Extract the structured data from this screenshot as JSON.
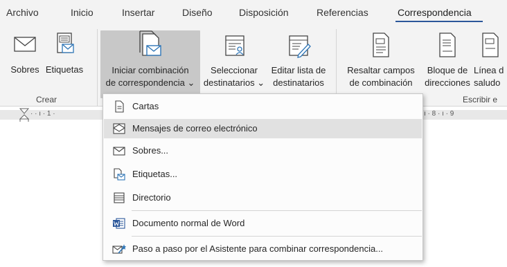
{
  "tabs": [
    "Archivo",
    "Inicio",
    "Insertar",
    "Diseño",
    "Disposición",
    "Referencias",
    "Correspondencia"
  ],
  "ribbon": {
    "sobres": "Sobres",
    "etiquetas": "Etiquetas",
    "iniciar_line1": "Iniciar combinación",
    "iniciar_line2": "de correspondencia",
    "seleccionar_line1": "Seleccionar",
    "seleccionar_line2": "destinatarios",
    "editar_line1": "Editar lista de",
    "editar_line2": "destinatarios",
    "resaltar_line1": "Resaltar campos",
    "resaltar_line2": "de combinación",
    "bloque_line1": "Bloque de",
    "bloque_line2": "direcciones",
    "linea_line1": "Línea d",
    "linea_line2": "saludo",
    "group_crear": "Crear",
    "group_escribir": "Escribir e",
    "dropdown_arrow": "⌄"
  },
  "ruler": {
    "left_marks": "·  ·  ı  ·  1  ·",
    "right_marks": "ı  ·  8  ·  ı  ·  9"
  },
  "menu": {
    "items": [
      {
        "label": "Cartas"
      },
      {
        "label": "Mensajes de correo electrónico"
      },
      {
        "label": "Sobres..."
      },
      {
        "label": "Etiquetas..."
      },
      {
        "label": "Directorio"
      },
      {
        "label": "Documento normal de Word"
      },
      {
        "label": "Paso a paso por el Asistente para combinar correspondencia..."
      }
    ]
  },
  "colors": {
    "accent": "#2b579a",
    "word_blue": "#2b579a",
    "envelope_blue": "#2e75b6",
    "highlight": "#e1e1e1",
    "pressed": "#c8c8c8"
  },
  "icons": {
    "cartas": "document-icon",
    "mensajes": "envelope-open-icon",
    "sobres": "envelope-icon",
    "etiquetas": "label-icon",
    "directorio": "list-icon",
    "documento_word": "word-icon",
    "asistente": "wizard-icon"
  }
}
